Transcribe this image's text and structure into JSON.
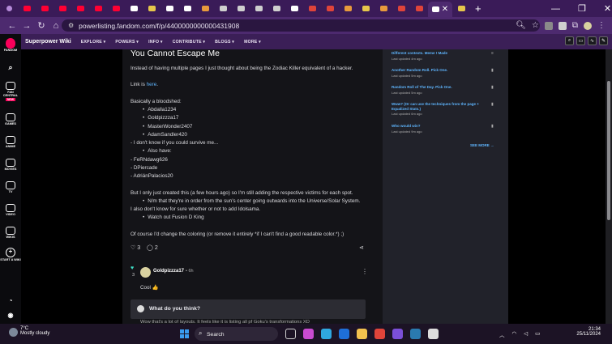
{
  "browser": {
    "url": "powerlisting.fandom.com/f/p/4400000000000431908",
    "tab_favicon_colors": [
      "#ff0033",
      "#ff0033",
      "#ff0033",
      "#ff0033",
      "#ff0033",
      "#ff0033",
      "#ffffff",
      "#e6c64b",
      "#ffffff",
      "#ffffff",
      "#e89a3c",
      "#cfcfcf",
      "#cfcfcf",
      "#cfcfcf",
      "#cfcfcf",
      "#ffffff",
      "#e0443a",
      "#e0443a",
      "#e89a3c",
      "#e6c64b",
      "#e89a3c",
      "#e0443a",
      "#e0443a",
      "#ffffff",
      "#e6c64b"
    ],
    "new_tab": "+",
    "window_controls": [
      "—",
      "❐",
      "✕"
    ]
  },
  "fandom_sidebar": {
    "logo_label": "FANDOM",
    "items": [
      {
        "label": "",
        "icon": "search-icon"
      },
      {
        "label": "FAN CENTRAL",
        "icon": "fan-central-icon",
        "badge": "NEW"
      },
      {
        "label": "GAMES",
        "icon": "games-icon"
      },
      {
        "label": "ANIME",
        "icon": "anime-icon"
      },
      {
        "label": "MOVIES",
        "icon": "movies-icon"
      },
      {
        "label": "TV",
        "icon": "tv-icon"
      },
      {
        "label": "VIDEO",
        "icon": "video-icon"
      },
      {
        "label": "WIKIS",
        "icon": "wikis-icon"
      },
      {
        "label": "START A WIKI",
        "icon": "plus-icon"
      }
    ]
  },
  "wiki_nav": {
    "name": "Superpower Wiki",
    "items": [
      "EXPLORE ▾",
      "POWERS ▾",
      "INFO ▾",
      "CONTRIBUTE ▾",
      "BLOGS ▾",
      "MORE ▾"
    ]
  },
  "post": {
    "title": "You Cannot Escape Me",
    "intro": "Instead of having multiple pages I just thought about being the Zodiac Killer equivalent of a hacker.",
    "link_prefix": "Link is ",
    "link_text": "here",
    "link_suffix": ".",
    "bloodshed_heading": "Basically a bloodshed:",
    "bloodshed_list": [
      "Abdalla1234",
      "Goldpizzza17",
      "MasterWonder2407",
      "AdamSandler420"
    ],
    "survive_line": "- I don't know if you could survive me...",
    "also_have_item": "Also have:",
    "dash_lines": [
      "- FeRNdawg626",
      "- DPiercade",
      "- AdriánPalacios20"
    ],
    "created_line": "But I only just created this (a few hours ago) so I'm still adding the respective victims for each spot.",
    "order_item": "N/m that they're in order from the sun's center going outwards into the Universe/Solar System.",
    "idolsama_line": "I also don't know for sure whether or not to add Idolsama.",
    "fusion_item": "Watch out Fusion D King",
    "coloring_line": "Of course I'd change the coloring (or remove it entirely *if I can't find a good readable color.*) ;)",
    "likes": "3",
    "comments": "2"
  },
  "comment": {
    "vote_count": "3",
    "author": "Goldpizzza17",
    "time": "• 6h",
    "text": "Cool 👍",
    "reply_prompt": "What do you think?",
    "next_reply_peek": "Wow that's a lot of layouts. It feels like it is listing all pf Goku's transformations XD"
  },
  "rail": {
    "items": [
      {
        "title": "Different contexts. Meme ! Made",
        "meta": "Last updated 4m ago"
      },
      {
        "title": "Another Random Roll. Pick One.",
        "meta": "Last updated 5m ago"
      },
      {
        "title": "Random Roll of The Day. Pick One.",
        "meta": "Last updated 5m ago"
      },
      {
        "title": "Www? (Or can use the techniques from the page + Equalized Stats.)",
        "meta": "Last updated 6m ago"
      },
      {
        "title": "Who would win?",
        "meta": "Last updated 9m ago"
      }
    ],
    "see_more": "SEE MORE →"
  },
  "taskbar": {
    "temp": "7°C",
    "weather": "Mostly cloudy",
    "search_placeholder": "Search",
    "time": "21:34",
    "date": "25/11/2024",
    "pinned_colors": [
      "#cfcfcf",
      "#c94bd0",
      "#2fa8e0",
      "#1e6fd8",
      "#f2c14e",
      "#e0443a",
      "#7b4fd8",
      "#2a7ab0",
      "#dddddd"
    ]
  }
}
